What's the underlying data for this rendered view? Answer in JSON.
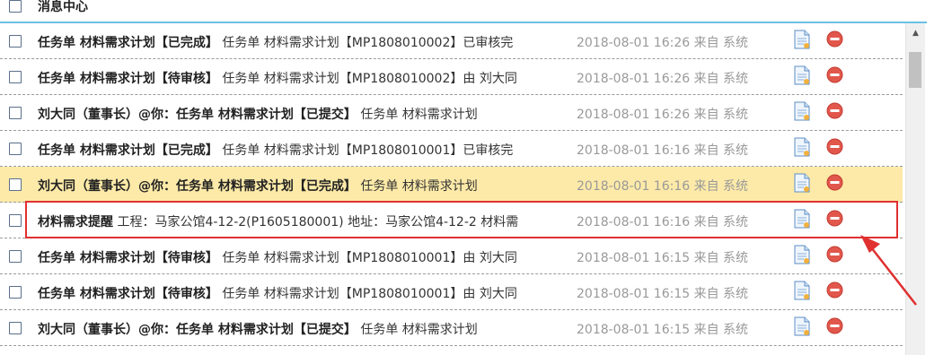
{
  "header": {
    "title": "消息中心"
  },
  "rows": [
    {
      "bold": "任务单 材料需求计划【已完成】",
      "rest": " 任务单 材料需求计划【MP1808010002】已审核完",
      "time": "2018-08-01 16:26 来自 系统",
      "highlight": false
    },
    {
      "bold": "任务单 材料需求计划【待审核】",
      "rest": " 任务单 材料需求计划【MP1808010002】由 刘大同",
      "time": "2018-08-01 16:26 来自 系统",
      "highlight": false
    },
    {
      "bold": "刘大同（董事长）@你：任务单 材料需求计划【已提交】",
      "rest": " 任务单 材料需求计划",
      "time": "2018-08-01 16:26 来自 系统",
      "highlight": false
    },
    {
      "bold": "任务单 材料需求计划【已完成】",
      "rest": " 任务单 材料需求计划【MP1808010001】已审核完",
      "time": "2018-08-01 16:16 来自 系统",
      "highlight": false
    },
    {
      "bold": "刘大同（董事长）@你：任务单 材料需求计划【已完成】",
      "rest": " 任务单 材料需求计划",
      "time": "2018-08-01 16:16 来自 系统",
      "highlight": true
    },
    {
      "bold": "材料需求提醒",
      "rest": " 工程：马家公馆4-12-2(P1605180001) 地址：马家公馆4-12-2 材料需",
      "time": "2018-08-01 16:16 来自 系统",
      "highlight": false
    },
    {
      "bold": "任务单 材料需求计划【待审核】",
      "rest": " 任务单 材料需求计划【MP1808010001】由 刘大同",
      "time": "2018-08-01 16:15 来自 系统",
      "highlight": false
    },
    {
      "bold": "任务单 材料需求计划【待审核】",
      "rest": " 任务单 材料需求计划【MP1808010001】由 刘大同",
      "time": "2018-08-01 16:15 来自 系统",
      "highlight": false
    },
    {
      "bold": "刘大同（董事长）@你：任务单 材料需求计划【已提交】",
      "rest": " 任务单 材料需求计划",
      "time": "2018-08-01 16:15 来自 系统",
      "highlight": false
    }
  ],
  "colors": {
    "highlight_row": "#fdeaa8",
    "annotation": "#e03030",
    "header_rule": "#6cc0e5"
  },
  "icons": {
    "view": "document-icon",
    "delete": "delete-icon"
  }
}
